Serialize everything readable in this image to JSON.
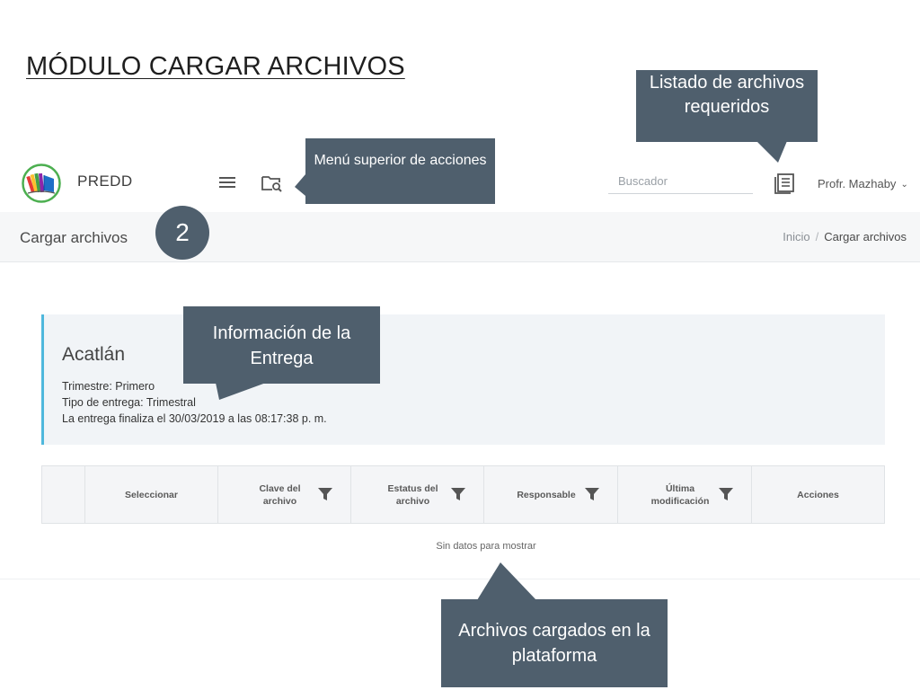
{
  "slide_title": "MÓDULO CARGAR ARCHIVOS",
  "app": {
    "brand": "PREDD",
    "icons": {
      "logo": "books-logo",
      "menu": "hamburger-menu-icon",
      "folder": "folder-search-icon",
      "list": "document-list-icon",
      "chevron": "chevron-down-icon"
    },
    "search": {
      "placeholder": "Buscador",
      "value": ""
    },
    "user": {
      "name": "Profr. Mazhaby"
    },
    "page_title": "Cargar archivos",
    "breadcrumb": {
      "home": "Inicio",
      "separator": "/",
      "current": "Cargar archivos"
    },
    "step": "2",
    "delivery": {
      "title": "Acatlán",
      "lines": [
        "Trimestre: Primero",
        "Tipo de entrega: Trimestral",
        "La entrega finaliza el 30/03/2019 a las 08:17:38 p. m."
      ]
    },
    "table": {
      "columns": [
        {
          "label": "",
          "filter": false
        },
        {
          "label": "Seleccionar",
          "filter": false
        },
        {
          "label": "Clave del archivo",
          "filter": true
        },
        {
          "label": "Estatus del archivo",
          "filter": true
        },
        {
          "label": "Responsable",
          "filter": true
        },
        {
          "label": "Última modificación",
          "filter": true
        },
        {
          "label": "Acciones",
          "filter": false
        }
      ],
      "empty_text": "Sin datos para mostrar"
    }
  },
  "callouts": {
    "list": "Listado de archivos requeridos",
    "menu": "Menú superior de acciones",
    "info": "Información de la Entrega",
    "files": "Archivos cargados en la plataforma"
  },
  "colors": {
    "callout": "#4f5f6d",
    "accent": "#4fb8dc",
    "subheader": "#f6f7f8",
    "card": "#f1f4f7"
  }
}
